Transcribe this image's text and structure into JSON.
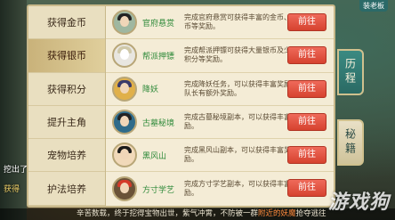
{
  "categories": [
    {
      "label": "获得金币"
    },
    {
      "label": "获得银币",
      "active": true
    },
    {
      "label": "获得积分"
    },
    {
      "label": "提升主角"
    },
    {
      "label": "宠物培养"
    },
    {
      "label": "护法培养"
    }
  ],
  "rows": [
    {
      "name": "官府悬赏",
      "desc": "完成官府悬赏可获得丰富的金币、银币等奖励。",
      "btn": "前往",
      "icon": "npc-portrait-icon"
    },
    {
      "name": "帮派押镖",
      "desc": "完成帮派押镖可获得大量银币及少量积分等奖励。",
      "btn": "前往",
      "icon": "owl-portrait-icon"
    },
    {
      "name": "降妖",
      "desc": "完成降妖任务，可以获得丰富奖励，队长有额外奖励。",
      "btn": "前往",
      "icon": "demon-portrait-icon"
    },
    {
      "name": "古墓秘境",
      "desc": "完成古墓秘境副本，可以获得丰富奖励。",
      "btn": "前往",
      "icon": "tomb-portrait-icon"
    },
    {
      "name": "黑风山",
      "desc": "完成黑风山副本，可以获得丰富奖励。",
      "btn": "前往",
      "icon": "blackwind-portrait-icon"
    },
    {
      "name": "方寸学艺",
      "desc": "完成方寸学艺副本，可以获得丰富奖励。",
      "btn": "前往",
      "icon": "fangcun-portrait-icon"
    }
  ],
  "tabs": {
    "history": "历程",
    "secret": "秘籍"
  },
  "side": {
    "text1": "挖出了",
    "text2": "获得"
  },
  "top_right": "装老板",
  "chat": {
    "prefix": "辛苦数载，终于挖得宝物出世，紫气冲霄，不防被一群",
    "highlight": "附近的妖魔",
    "suffix": "抢夺逃往"
  },
  "watermark": "游戏狗"
}
